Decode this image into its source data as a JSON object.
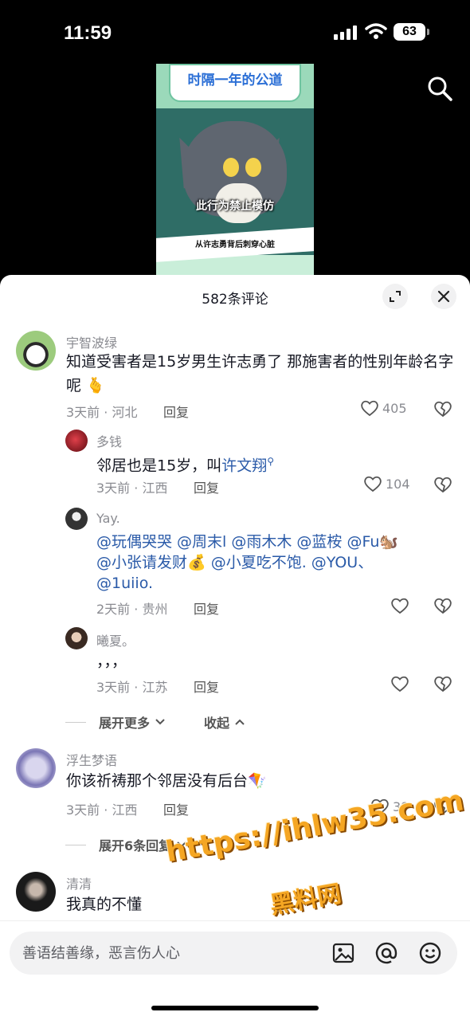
{
  "status_bar": {
    "time": "11:59",
    "battery": "63"
  },
  "video": {
    "title": "时隔一年的公道",
    "subtitle": "此行为禁止模仿",
    "caption": "从许志勇背后刺穿心脏"
  },
  "sheet": {
    "title": "582条评论"
  },
  "comments": [
    {
      "user": "宇智波绿",
      "text": "知道受害者是15岁男生许志勇了 那施害者的性别年龄名字呢",
      "emoji": "🫰",
      "meta": "3天前 · 河北",
      "reply": "回复",
      "likes": "405"
    },
    {
      "user": "多钱",
      "text": "邻居也是15岁，叫",
      "link": "许文翔",
      "meta": "3天前 · 江西",
      "reply": "回复",
      "likes": "104"
    },
    {
      "user": "Yay.",
      "text_line1": "@玩偶哭哭 @周末l @雨木木 @蓝桉 @Fu🐿️",
      "text_line2": "@小张请发财💰 @小夏吃不饱. @YOU、",
      "text_line3": "@1uiio.",
      "meta": "2天前 · 贵州",
      "reply": "回复",
      "likes": ""
    },
    {
      "user": "曦夏。",
      "text": "，，，",
      "meta": "3天前 · 江苏",
      "reply": "回复",
      "likes": ""
    },
    {
      "user": "浮生梦语",
      "text": "你该祈祷那个邻居没有后台",
      "emoji": "🪁",
      "meta": "3天前 · 江西",
      "reply": "回复",
      "likes": "39"
    },
    {
      "user": "清清",
      "text": "我真的不懂"
    }
  ],
  "expand_more": "展开更多",
  "collapse": "收起",
  "expand_replies": "展开6条回复",
  "watermark": {
    "line1": "https://ihlw35.com",
    "line2": "黑料网"
  },
  "input": {
    "placeholder": "善语结善缘，恶言伤人心"
  },
  "icons": [
    "search-icon",
    "fullscreen-icon",
    "close-icon",
    "heart-icon",
    "dislike-icon",
    "image-icon",
    "at-icon",
    "emoji-icon"
  ]
}
